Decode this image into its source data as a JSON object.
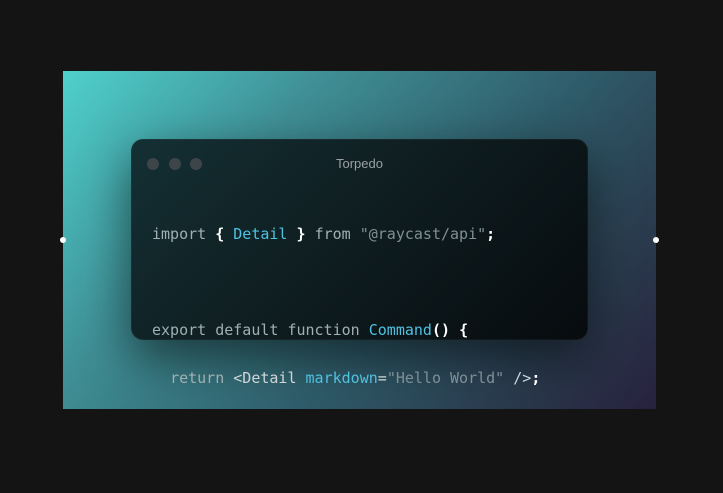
{
  "window": {
    "title": "Torpedo"
  },
  "code": {
    "line1": {
      "import_kw": "import",
      "brace_open": "{",
      "identifier": "Detail",
      "brace_close": "}",
      "from_kw": "from",
      "module": "\"@raycast/api\"",
      "semicolon": ";"
    },
    "line3": {
      "export_kw": "export default function",
      "fn_name": "Command",
      "parens": "()",
      "brace_open": "{"
    },
    "line4": {
      "return_kw": "return",
      "tag_open": "<Detail",
      "attr": "markdown",
      "equals": "=",
      "attr_value": "\"Hello World\"",
      "tag_close": "/>",
      "semicolon": ";"
    },
    "line5": {
      "brace_close": "}"
    }
  },
  "colors": {
    "background": "#141414",
    "gradient_start": "#4fd0cc",
    "gradient_end": "#27213d",
    "window_bg": "#0f1e21",
    "identifier": "#4fc1e0",
    "string": "#7f8f95"
  }
}
